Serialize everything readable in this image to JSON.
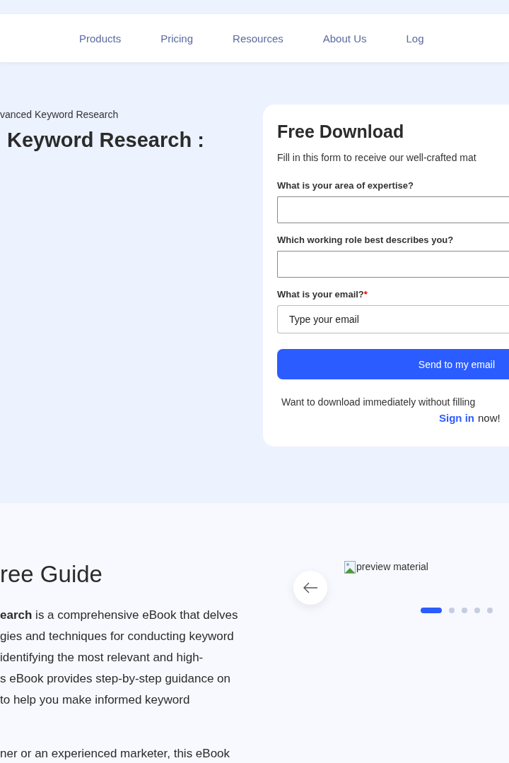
{
  "nav": {
    "items": [
      "Products",
      "Pricing",
      "Resources",
      "About Us",
      "Log"
    ]
  },
  "hero": {
    "breadcrumb": "vanced Keyword Research",
    "title": "Keyword Research :"
  },
  "form": {
    "title": "Free Download",
    "intro": "Fill in this form to receive our well-crafted mat",
    "required_mark": "*",
    "fields": [
      {
        "label": "What is your area of expertise?",
        "required": false
      },
      {
        "label": "Which working role best describes you?",
        "required": false
      },
      {
        "label": "What is your email?",
        "required": true,
        "placeholder": "Type your email"
      }
    ],
    "button": "Send to my email",
    "footer_text": "Want to download immediately without filling",
    "sign_in_link": "Sign in",
    "footer_suffix": "now!"
  },
  "guide": {
    "title": "ree Guide",
    "paragraphs": [
      [
        "**earch** is a comprehensive eBook that delves",
        "gies and techniques for conducting keyword",
        "identifying the most relevant and high-",
        "s eBook provides step-by-step guidance on",
        "to help you make informed keyword"
      ],
      [
        "ner or an experienced marketer, this eBook"
      ]
    ]
  },
  "carousel": {
    "image_alt": "preview material",
    "dots": [
      {
        "selected": true
      },
      {
        "selected": false
      },
      {
        "selected": false
      },
      {
        "selected": false
      },
      {
        "selected": false
      }
    ]
  }
}
